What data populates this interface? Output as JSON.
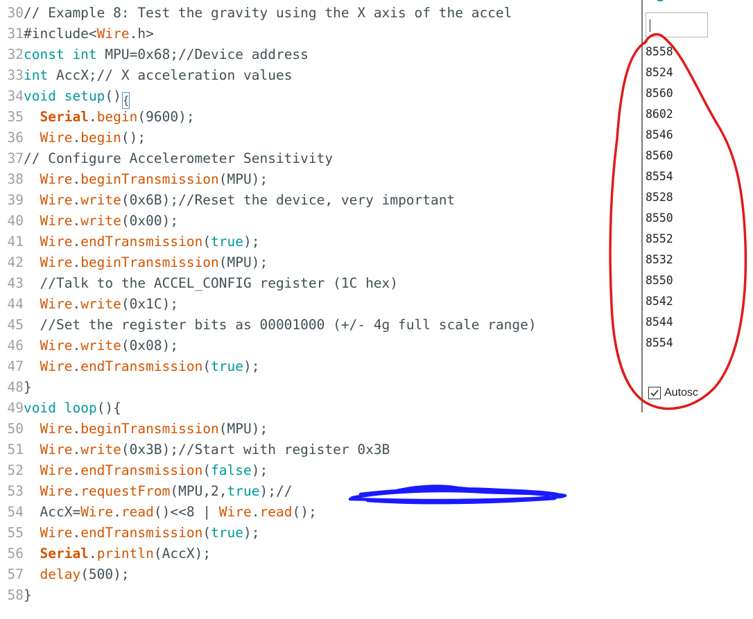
{
  "editor": {
    "lines": [
      {
        "num": "30",
        "tokens": [
          {
            "t": "cm",
            "v": "// Example 8: Test the gravity using the X axis of the accel"
          }
        ]
      },
      {
        "num": "31",
        "tokens": [
          {
            "t": "tx",
            "v": "#include<"
          },
          {
            "t": "fn",
            "v": "Wire"
          },
          {
            "t": "tx",
            "v": ".h>"
          }
        ]
      },
      {
        "num": "32",
        "tokens": [
          {
            "t": "kw",
            "v": "const int"
          },
          {
            "t": "tx",
            "v": " MPU=0x68;//Device address"
          }
        ]
      },
      {
        "num": "33",
        "tokens": [
          {
            "t": "kw",
            "v": "int"
          },
          {
            "t": "tx",
            "v": " AccX;// X acceleration values"
          }
        ]
      },
      {
        "num": "34",
        "tokens": [
          {
            "t": "kw",
            "v": "void"
          },
          {
            "t": "tx",
            "v": " "
          },
          {
            "t": "kw",
            "v": "setup"
          },
          {
            "t": "tx",
            "v": "()"
          },
          {
            "t": "caret",
            "v": "{"
          }
        ]
      },
      {
        "num": "35",
        "tokens": [
          {
            "t": "tx",
            "v": "  "
          },
          {
            "t": "cls",
            "v": "Serial"
          },
          {
            "t": "tx",
            "v": "."
          },
          {
            "t": "fn",
            "v": "begin"
          },
          {
            "t": "tx",
            "v": "(9600);"
          }
        ]
      },
      {
        "num": "36",
        "tokens": [
          {
            "t": "tx",
            "v": "  "
          },
          {
            "t": "fn",
            "v": "Wire"
          },
          {
            "t": "tx",
            "v": "."
          },
          {
            "t": "fn",
            "v": "begin"
          },
          {
            "t": "tx",
            "v": "();"
          }
        ]
      },
      {
        "num": "37",
        "tokens": [
          {
            "t": "cm",
            "v": "// Configure Accelerometer Sensitivity"
          }
        ]
      },
      {
        "num": "38",
        "tokens": [
          {
            "t": "tx",
            "v": "  "
          },
          {
            "t": "fn",
            "v": "Wire"
          },
          {
            "t": "tx",
            "v": "."
          },
          {
            "t": "fn",
            "v": "beginTransmission"
          },
          {
            "t": "tx",
            "v": "(MPU);"
          }
        ]
      },
      {
        "num": "39",
        "tokens": [
          {
            "t": "tx",
            "v": "  "
          },
          {
            "t": "fn",
            "v": "Wire"
          },
          {
            "t": "tx",
            "v": "."
          },
          {
            "t": "fn",
            "v": "write"
          },
          {
            "t": "tx",
            "v": "(0x6B);//Reset the device, very important"
          }
        ]
      },
      {
        "num": "40",
        "tokens": [
          {
            "t": "tx",
            "v": "  "
          },
          {
            "t": "fn",
            "v": "Wire"
          },
          {
            "t": "tx",
            "v": "."
          },
          {
            "t": "fn",
            "v": "write"
          },
          {
            "t": "tx",
            "v": "(0x00);"
          }
        ]
      },
      {
        "num": "41",
        "tokens": [
          {
            "t": "tx",
            "v": "  "
          },
          {
            "t": "fn",
            "v": "Wire"
          },
          {
            "t": "tx",
            "v": "."
          },
          {
            "t": "fn",
            "v": "endTransmission"
          },
          {
            "t": "tx",
            "v": "("
          },
          {
            "t": "kw",
            "v": "true"
          },
          {
            "t": "tx",
            "v": ");"
          }
        ]
      },
      {
        "num": "42",
        "tokens": [
          {
            "t": "tx",
            "v": "  "
          },
          {
            "t": "fn",
            "v": "Wire"
          },
          {
            "t": "tx",
            "v": "."
          },
          {
            "t": "fn",
            "v": "beginTransmission"
          },
          {
            "t": "tx",
            "v": "(MPU);"
          }
        ]
      },
      {
        "num": "43",
        "tokens": [
          {
            "t": "cm",
            "v": "  //Talk to the ACCEL_CONFIG register (1C hex)"
          }
        ]
      },
      {
        "num": "44",
        "tokens": [
          {
            "t": "tx",
            "v": "  "
          },
          {
            "t": "fn",
            "v": "Wire"
          },
          {
            "t": "tx",
            "v": "."
          },
          {
            "t": "fn",
            "v": "write"
          },
          {
            "t": "tx",
            "v": "(0x1C);"
          }
        ]
      },
      {
        "num": "45",
        "tokens": [
          {
            "t": "cm",
            "v": "  //Set the register bits as 00001000 (+/- 4g full scale range)"
          }
        ]
      },
      {
        "num": "46",
        "tokens": [
          {
            "t": "tx",
            "v": "  "
          },
          {
            "t": "fn",
            "v": "Wire"
          },
          {
            "t": "tx",
            "v": "."
          },
          {
            "t": "fn",
            "v": "write"
          },
          {
            "t": "tx",
            "v": "(0x08);"
          }
        ]
      },
      {
        "num": "47",
        "tokens": [
          {
            "t": "tx",
            "v": "  "
          },
          {
            "t": "fn",
            "v": "Wire"
          },
          {
            "t": "tx",
            "v": "."
          },
          {
            "t": "fn",
            "v": "endTransmission"
          },
          {
            "t": "tx",
            "v": "("
          },
          {
            "t": "kw",
            "v": "true"
          },
          {
            "t": "tx",
            "v": ");"
          }
        ]
      },
      {
        "num": "48",
        "tokens": [
          {
            "t": "tx",
            "v": "}"
          }
        ]
      },
      {
        "num": "49",
        "tokens": [
          {
            "t": "kw",
            "v": "void"
          },
          {
            "t": "tx",
            "v": " "
          },
          {
            "t": "kw",
            "v": "loop"
          },
          {
            "t": "tx",
            "v": "(){"
          }
        ]
      },
      {
        "num": "50",
        "tokens": [
          {
            "t": "tx",
            "v": "  "
          },
          {
            "t": "fn",
            "v": "Wire"
          },
          {
            "t": "tx",
            "v": "."
          },
          {
            "t": "fn",
            "v": "beginTransmission"
          },
          {
            "t": "tx",
            "v": "(MPU);"
          }
        ]
      },
      {
        "num": "51",
        "tokens": [
          {
            "t": "tx",
            "v": "  "
          },
          {
            "t": "fn",
            "v": "Wire"
          },
          {
            "t": "tx",
            "v": "."
          },
          {
            "t": "fn",
            "v": "write"
          },
          {
            "t": "tx",
            "v": "(0x3B);//Start with register 0x3B"
          }
        ]
      },
      {
        "num": "52",
        "tokens": [
          {
            "t": "tx",
            "v": "  "
          },
          {
            "t": "fn",
            "v": "Wire"
          },
          {
            "t": "tx",
            "v": "."
          },
          {
            "t": "fn",
            "v": "endTransmission"
          },
          {
            "t": "tx",
            "v": "("
          },
          {
            "t": "kw",
            "v": "false"
          },
          {
            "t": "tx",
            "v": ");"
          }
        ]
      },
      {
        "num": "53",
        "tokens": [
          {
            "t": "tx",
            "v": "  "
          },
          {
            "t": "fn",
            "v": "Wire"
          },
          {
            "t": "tx",
            "v": "."
          },
          {
            "t": "fn",
            "v": "requestFrom"
          },
          {
            "t": "tx",
            "v": "(MPU,2,"
          },
          {
            "t": "kw",
            "v": "true"
          },
          {
            "t": "tx",
            "v": ");// "
          }
        ]
      },
      {
        "num": "54",
        "tokens": [
          {
            "t": "tx",
            "v": "  AccX="
          },
          {
            "t": "fn",
            "v": "Wire"
          },
          {
            "t": "tx",
            "v": "."
          },
          {
            "t": "fn",
            "v": "read"
          },
          {
            "t": "tx",
            "v": "()<<8 | "
          },
          {
            "t": "fn",
            "v": "Wire"
          },
          {
            "t": "tx",
            "v": "."
          },
          {
            "t": "fn",
            "v": "read"
          },
          {
            "t": "tx",
            "v": "();"
          }
        ]
      },
      {
        "num": "55",
        "tokens": [
          {
            "t": "tx",
            "v": "  "
          },
          {
            "t": "fn",
            "v": "Wire"
          },
          {
            "t": "tx",
            "v": "."
          },
          {
            "t": "fn",
            "v": "endTransmission"
          },
          {
            "t": "tx",
            "v": "("
          },
          {
            "t": "kw",
            "v": "true"
          },
          {
            "t": "tx",
            "v": ");"
          }
        ]
      },
      {
        "num": "56",
        "tokens": [
          {
            "t": "tx",
            "v": "  "
          },
          {
            "t": "cls",
            "v": "Serial"
          },
          {
            "t": "tx",
            "v": "."
          },
          {
            "t": "fn",
            "v": "println"
          },
          {
            "t": "tx",
            "v": "(AccX);"
          }
        ]
      },
      {
        "num": "57",
        "tokens": [
          {
            "t": "tx",
            "v": "  "
          },
          {
            "t": "fn",
            "v": "delay"
          },
          {
            "t": "tx",
            "v": "(500);"
          }
        ]
      },
      {
        "num": "58",
        "tokens": [
          {
            "t": "tx",
            "v": "}"
          }
        ]
      }
    ]
  },
  "serial_monitor": {
    "output_lines": [
      "8558",
      "8524",
      "8560",
      "8602",
      "8546",
      "8560",
      "8554",
      "8528",
      "8550",
      "8552",
      "8532",
      "8550",
      "8542",
      "8544",
      "8554"
    ],
    "autoscroll_label": "Autosc",
    "autoscroll_checked": true
  },
  "colors": {
    "annotation_red": "#e01b1b",
    "scribble_blue": "#1a1aff"
  }
}
